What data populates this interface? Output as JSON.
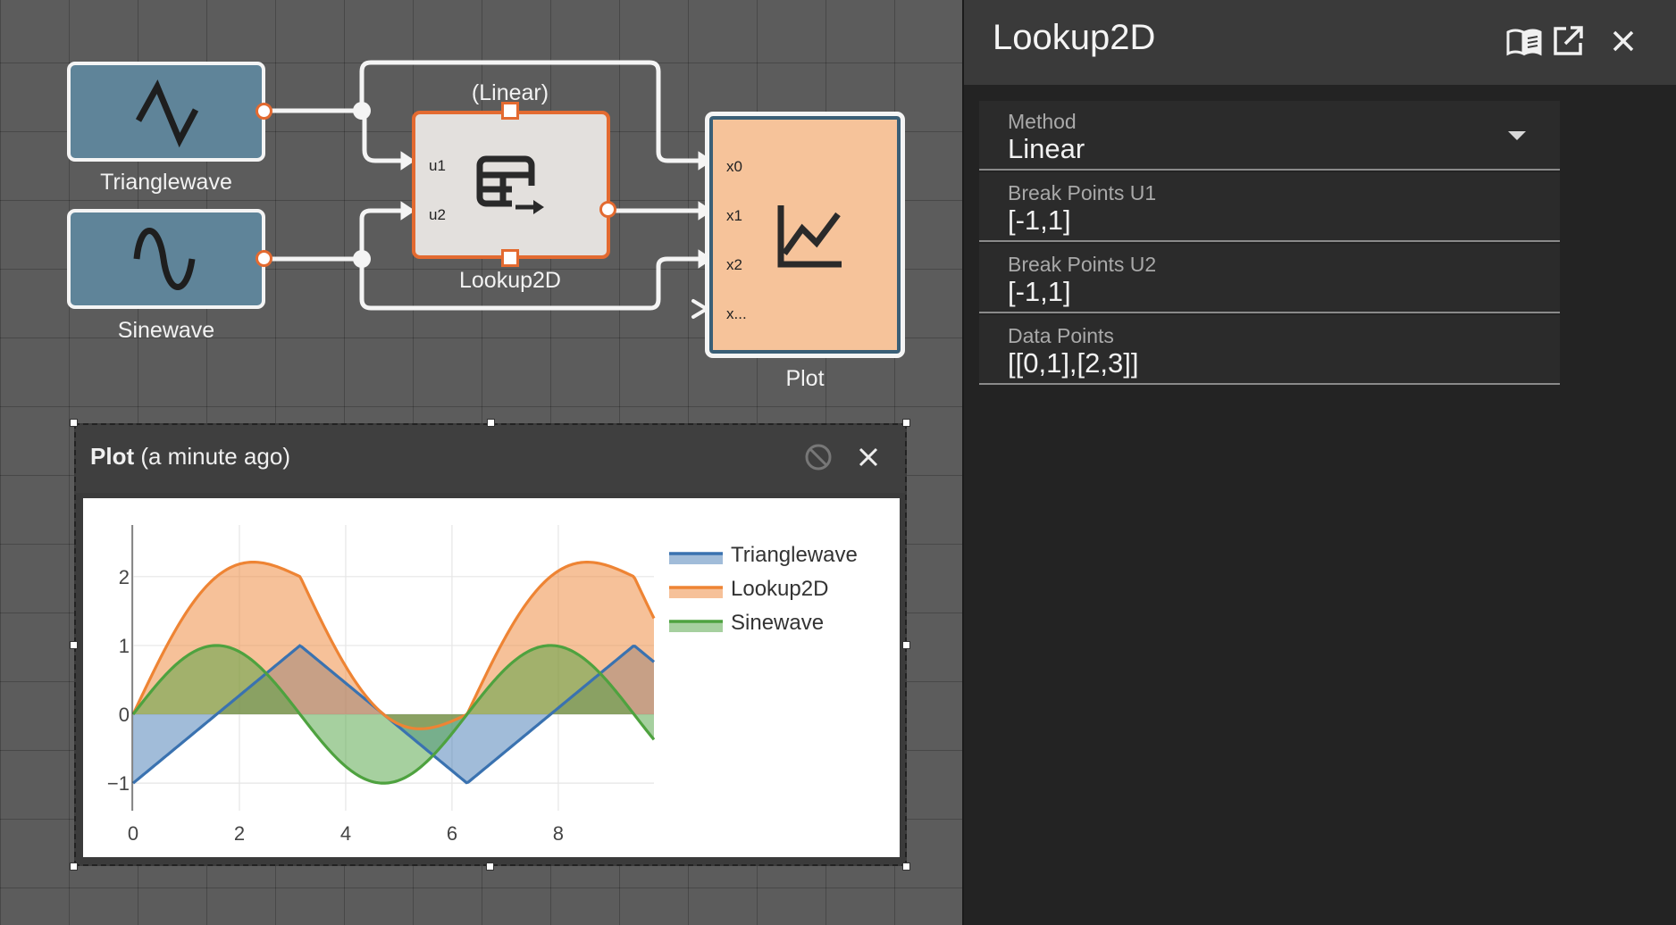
{
  "canvas": {
    "blocks": {
      "trianglewave": {
        "label": "Trianglewave"
      },
      "sinewave": {
        "label": "Sinewave"
      },
      "lookup": {
        "label": "Lookup2D",
        "mode": "(Linear)",
        "ports_in": [
          "u1",
          "u2"
        ]
      },
      "plot": {
        "label": "Plot",
        "ports_in": [
          "x0",
          "x1",
          "x2",
          "x..."
        ]
      }
    }
  },
  "plot_window": {
    "title": "Plot",
    "subtitle": "(a minute ago)",
    "icons": {
      "disable": "block-icon",
      "close": "close-icon"
    }
  },
  "chart_data": {
    "type": "area",
    "x_range": [
      0,
      9.8
    ],
    "xlim": [
      0,
      9.8
    ],
    "ylim": [
      -1.4,
      2.75
    ],
    "x_ticks": [
      0,
      2,
      4,
      6,
      8
    ],
    "y_ticks": [
      -1,
      0,
      1,
      2
    ],
    "x_tick_labels": [
      "0",
      "2",
      "4",
      "6",
      "8"
    ],
    "y_tick_labels": [
      "−1",
      "0",
      "1",
      "2"
    ],
    "grid": true,
    "legend_position": "right",
    "series": [
      {
        "name": "Trianglewave",
        "color": "#3a72b0",
        "fill": "rgba(58,114,176,0.48)",
        "function": "triangle",
        "period": 6.2832,
        "amplitude": 1
      },
      {
        "name": "Lookup2D",
        "color": "#ee8434",
        "fill": "rgba(238,132,52,0.5)",
        "function": "lookup_sum_plus_one",
        "inputs": [
          "Trianglewave",
          "Sinewave"
        ]
      },
      {
        "name": "Sinewave",
        "color": "#4ea23f",
        "fill": "rgba(78,162,63,0.5)",
        "function": "sin",
        "period": 6.2832,
        "amplitude": 1
      }
    ]
  },
  "panel": {
    "title": "Lookup2D",
    "icons": {
      "docs": "book-icon",
      "popout": "open-in-new-icon",
      "close": "close-icon"
    },
    "fields": [
      {
        "label": "Method",
        "value": "Linear",
        "type": "select"
      },
      {
        "label": "Break Points U1",
        "value": "[-1,1]",
        "type": "text"
      },
      {
        "label": "Break Points U2",
        "value": "[-1,1]",
        "type": "text"
      },
      {
        "label": "Data Points",
        "value": "[[0,1],[2,3]]",
        "type": "text"
      }
    ]
  },
  "colors": {
    "source_block": "#5f8499",
    "lookup_block": "#e3e0dd",
    "lookup_accent": "#e36a30",
    "plot_block": "#f6c39a",
    "plot_border": "#3a5f77"
  }
}
